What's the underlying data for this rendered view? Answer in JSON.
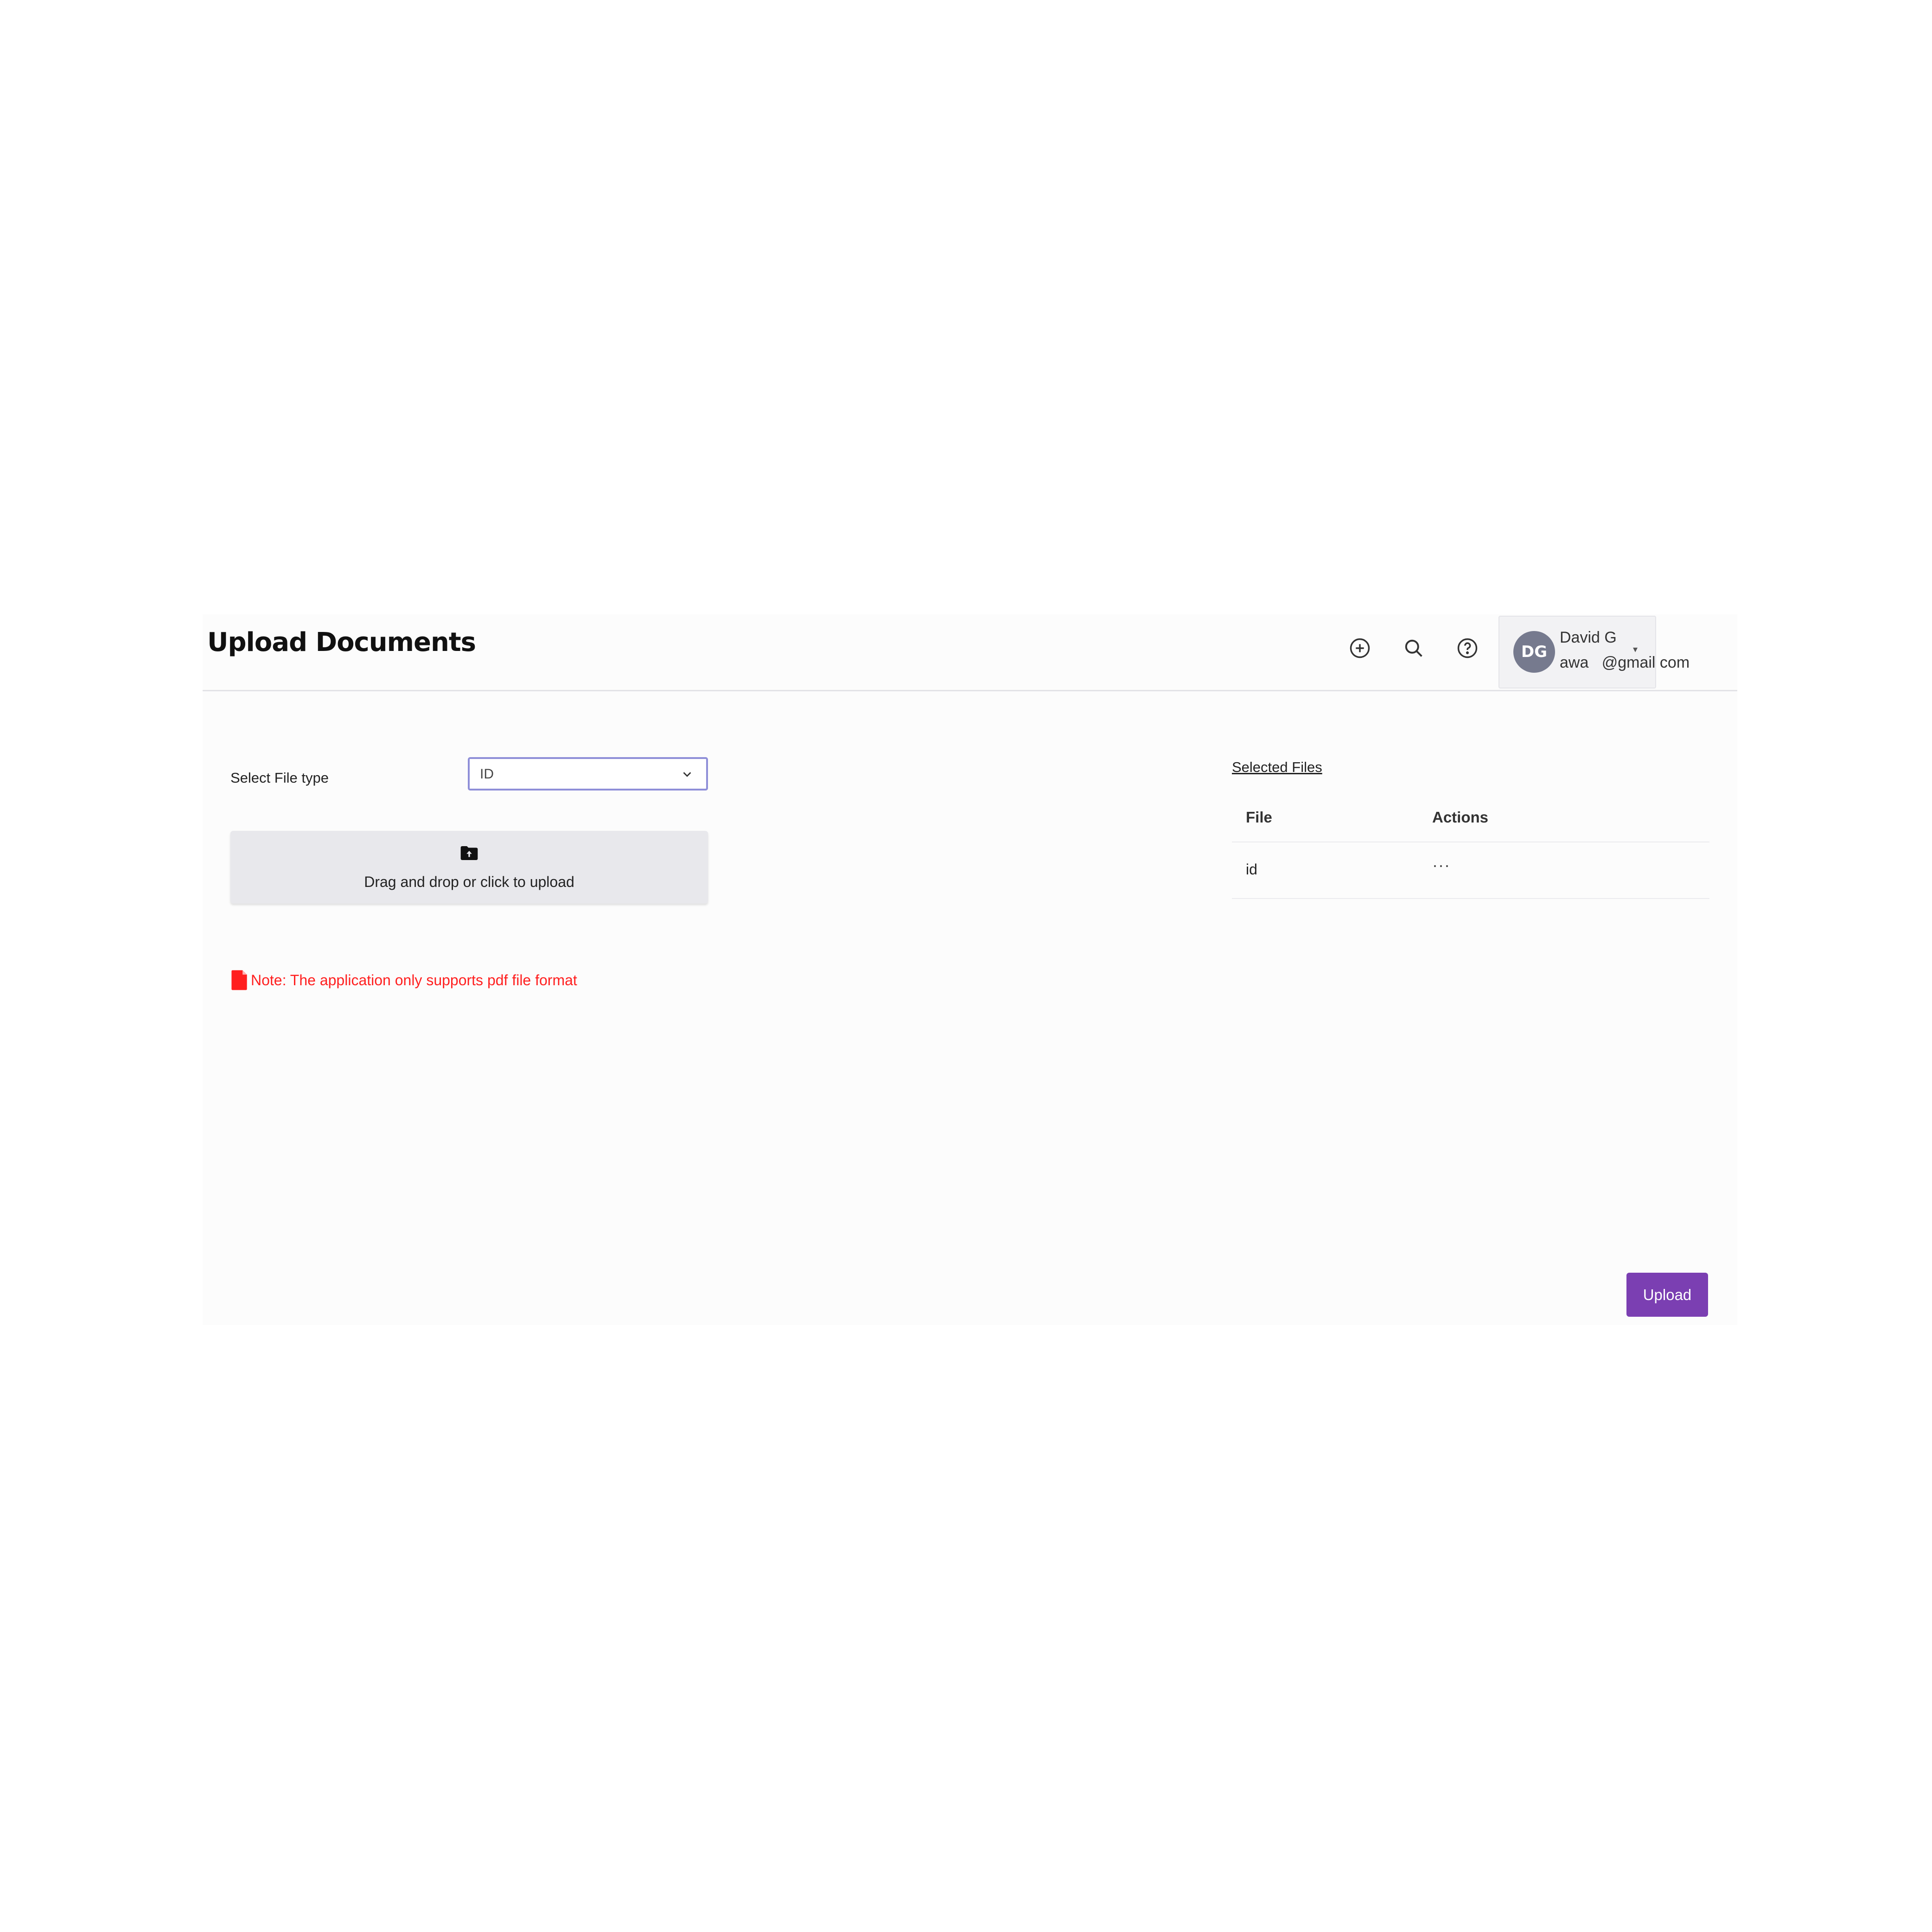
{
  "header": {
    "title": "Upload Documents",
    "icons": [
      "add-circle-icon",
      "search-icon",
      "help-icon"
    ],
    "user": {
      "initials": "DG",
      "name": "David G",
      "email": "awa   @gmail com"
    }
  },
  "form": {
    "file_type_label": "Select File type",
    "file_type_value": "ID",
    "dropzone_text": "Drag and drop or click to upload",
    "note": "Note: The application only supports pdf file format"
  },
  "selected_files": {
    "title": "Selected Files",
    "columns": [
      "File",
      "Actions"
    ],
    "rows": [
      {
        "file": "id",
        "actions": "···"
      }
    ]
  },
  "footer": {
    "upload_label": "Upload"
  },
  "colors": {
    "accent": "#7b3fb2",
    "avatar": "#767a8e",
    "note": "#ff1f1f",
    "select_border": "#8f8fd8"
  }
}
